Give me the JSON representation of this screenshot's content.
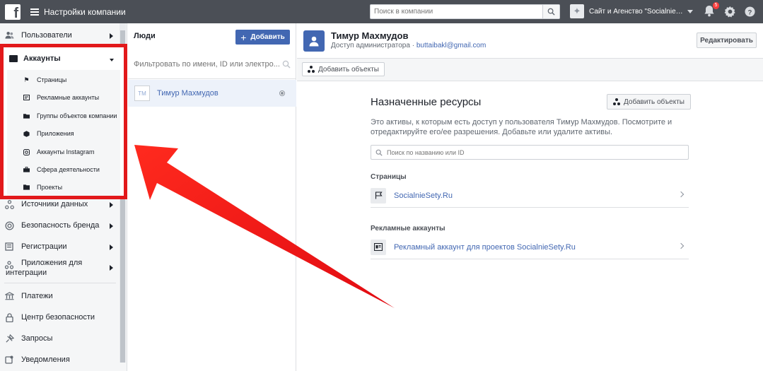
{
  "topbar": {
    "title": "Настройки компании",
    "search_placeholder": "Поиск в компании",
    "company_name": "Сайт и Агенство \"Socialnie…",
    "notifications_count": "5"
  },
  "sidebar": {
    "users": "Пользователи",
    "accounts": "Аккаунты",
    "sub_items": [
      {
        "label": "Страницы"
      },
      {
        "label": "Рекламные аккаунты"
      },
      {
        "label": "Группы объектов компании"
      },
      {
        "label": "Приложения"
      },
      {
        "label": "Аккаунты Instagram"
      },
      {
        "label": "Сфера деятельности"
      },
      {
        "label": "Проекты"
      }
    ],
    "data_sources": "Источники данных",
    "brand_safety": "Безопасность бренда",
    "registrations": "Регистрации",
    "integrations_line1": "Приложения для",
    "integrations_line2": "интеграции",
    "payments": "Платежи",
    "security_center": "Центр безопасности",
    "requests": "Запросы",
    "notifications": "Уведомления"
  },
  "people": {
    "title": "Люди",
    "add_label": "Добавить",
    "filter_placeholder": "Фильтровать по имени, ID или электро...",
    "person": {
      "initials": "TM",
      "name": "Тимур Махмудов"
    }
  },
  "detail": {
    "name": "Тимур Махмудов",
    "role": "Доступ администратора",
    "separator": " · ",
    "email": "buttaibakl@gmail.com",
    "edit_label": "Редактировать",
    "add_objects_label": "Добавить объекты",
    "section_title": "Назначенные ресурсы",
    "section_desc": "Это активы, к которым есть доступ у пользователя Тимур Махмудов. Посмотрите и отредактируйте его/ее разрешения. Добавьте или удалите активы.",
    "resource_search_placeholder": "Поиск по названию или ID",
    "pages_title": "Страницы",
    "page_item": "SocialnieSety.Ru",
    "ad_accounts_title": "Рекламные аккаунты",
    "ad_account_item": "Рекламный аккаунт для проектов SocialnieSety.Ru"
  },
  "colors": {
    "topbar": "#4b4f56",
    "accent": "#4267b2",
    "highlight_box": "#e2191b",
    "arrow": "#f0141a"
  }
}
